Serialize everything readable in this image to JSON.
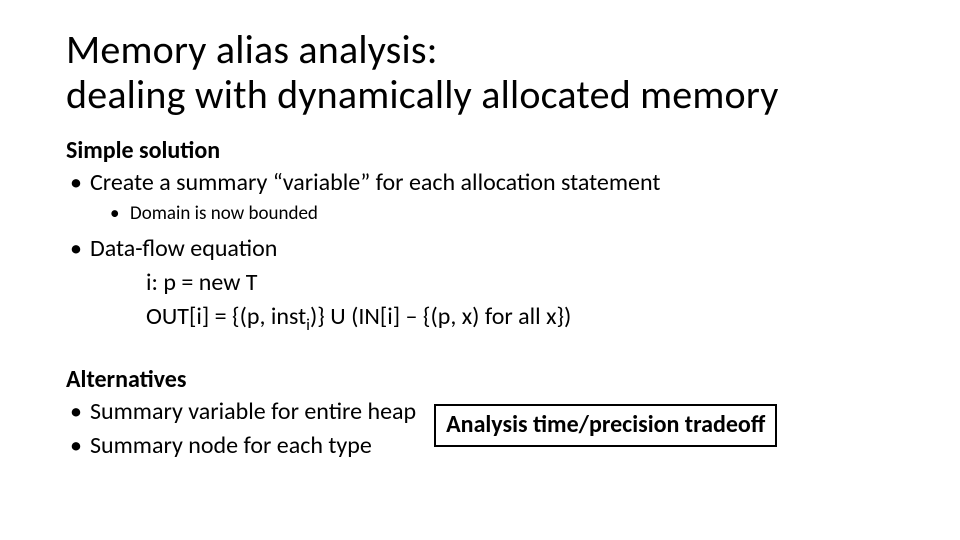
{
  "title_line1": "Memory alias analysis:",
  "title_line2": "dealing with dynamically allocated memory",
  "section1": {
    "heading": "Simple solution",
    "bullet1": "Create a summary “variable” for each allocation statement",
    "sub1": "Domain is now bounded",
    "bullet2": "Data-flow equation",
    "eq_line1": "i: p = new T",
    "eq_line2_pre": "OUT[i] = {(p, inst",
    "eq_line2_sub": "i",
    "eq_line2_post": ")} U (IN[i] – {(p, x) for all x})"
  },
  "section2": {
    "heading": "Alternatives",
    "bullet1": "Summary variable for entire heap",
    "bullet2": "Summary node for each type",
    "tradeoff": "Analysis time/precision tradeoff"
  }
}
